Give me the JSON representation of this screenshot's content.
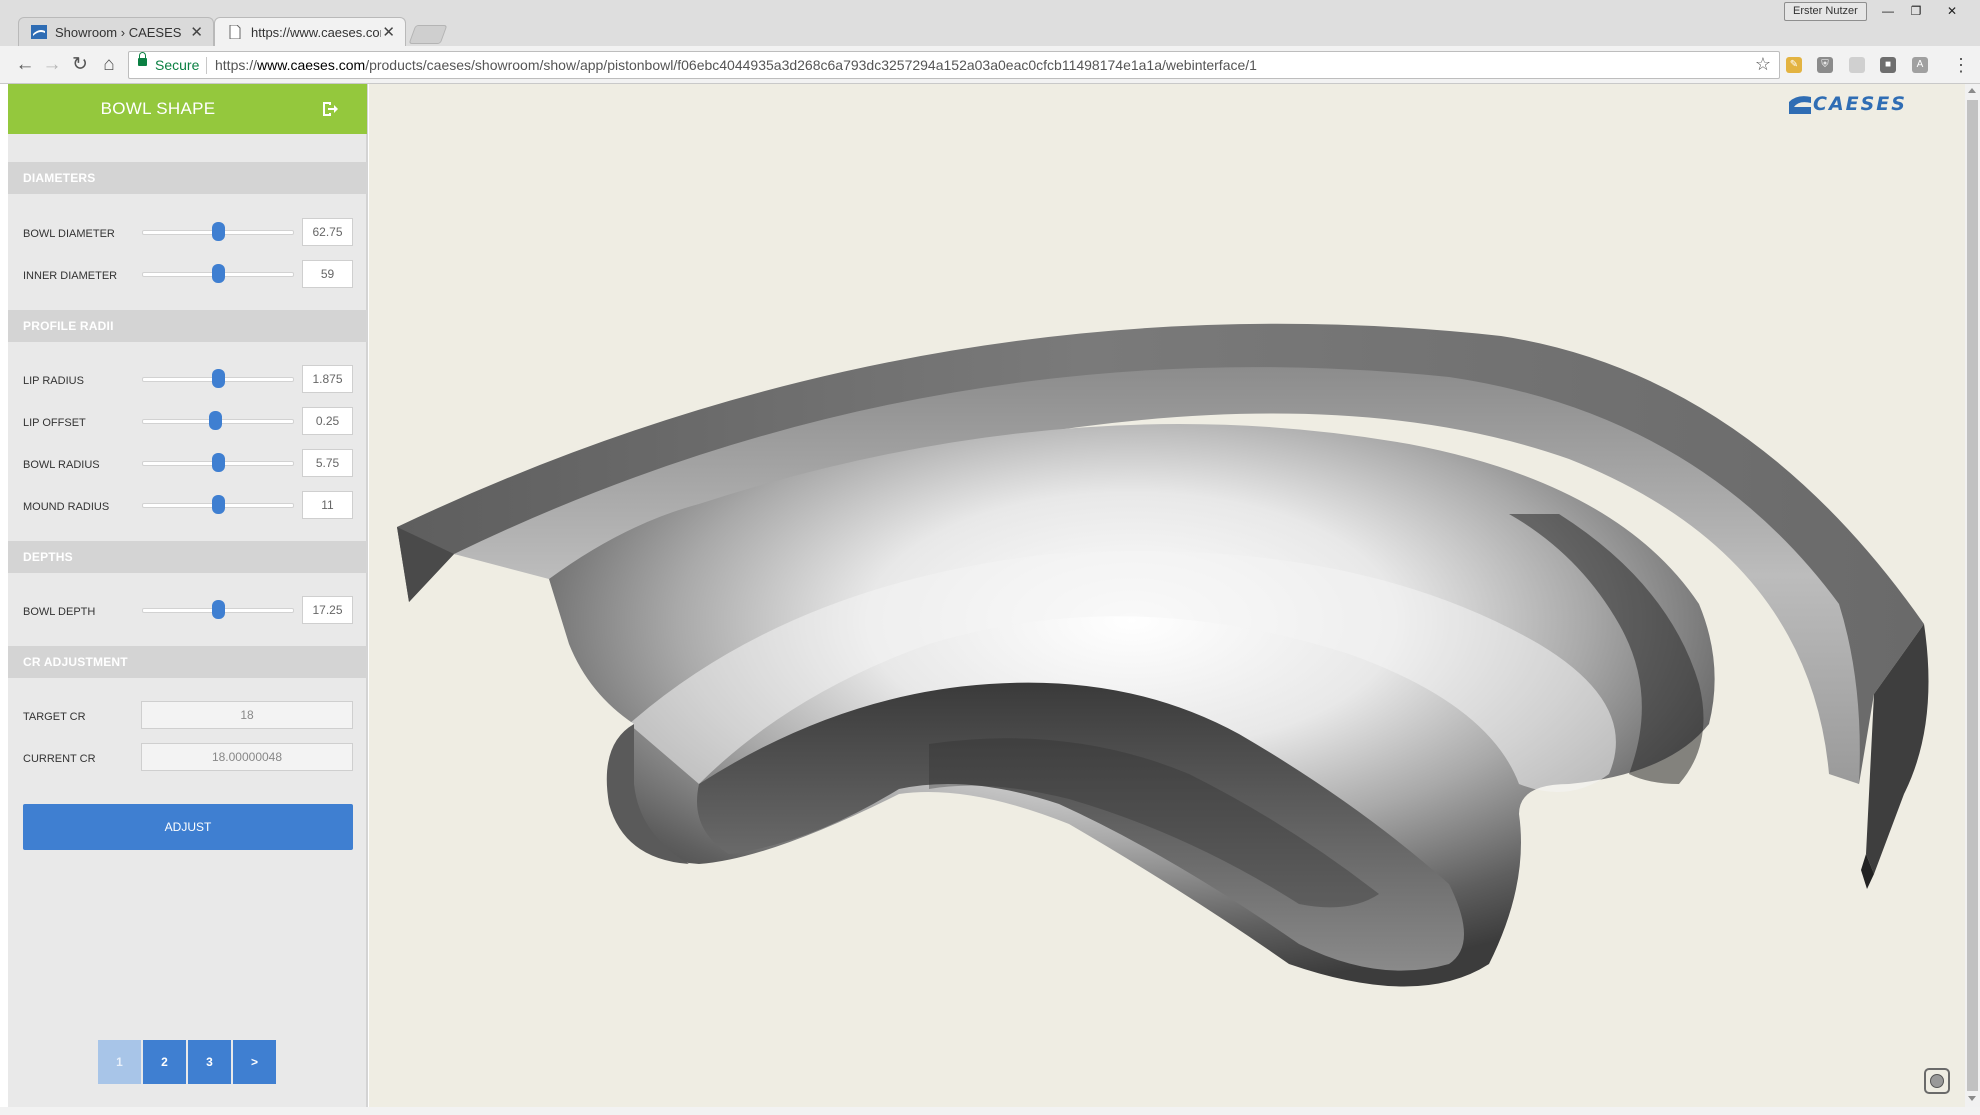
{
  "browser": {
    "tabs": [
      {
        "title": "Showroom › CAESES",
        "active": false
      },
      {
        "title": "https://www.caeses.com/",
        "active": true
      }
    ],
    "profile_label": "Erster Nutzer",
    "window_controls": {
      "minimize": "—",
      "restore": "❐",
      "close": "✕"
    },
    "security_label": "Secure",
    "url_scheme": "https://",
    "url_host": "www.caeses.com",
    "url_path": "/products/caeses/showroom/show/app/pistonbowl/f06ebc4044935a3d268c6a793dc3257294a152a03a0eac0cfcb11498174e1a1a/webinterface/1"
  },
  "panel": {
    "title": "BOWL SHAPE",
    "sections": {
      "diameters": {
        "heading": "DIAMETERS",
        "params": [
          {
            "label": "BOWL DIAMETER",
            "value": "62.75",
            "slider_fraction": 0.5
          },
          {
            "label": "INNER DIAMETER",
            "value": "59",
            "slider_fraction": 0.5
          }
        ]
      },
      "profile_radii": {
        "heading": "PROFILE RADII",
        "params": [
          {
            "label": "LIP RADIUS",
            "value": "1.875",
            "slider_fraction": 0.5
          },
          {
            "label": "LIP OFFSET",
            "value": "0.25",
            "slider_fraction": 0.48
          },
          {
            "label": "BOWL RADIUS",
            "value": "5.75",
            "slider_fraction": 0.5
          },
          {
            "label": "MOUND RADIUS",
            "value": "11",
            "slider_fraction": 0.5
          }
        ]
      },
      "depths": {
        "heading": "DEPTHS",
        "params": [
          {
            "label": "BOWL DEPTH",
            "value": "17.25",
            "slider_fraction": 0.5
          }
        ]
      },
      "cr_adjustment": {
        "heading": "CR ADJUSTMENT",
        "target_label": "TARGET CR",
        "target_value": "18",
        "current_label": "CURRENT CR",
        "current_value": "18.00000048"
      }
    },
    "adjust_label": "ADJUST",
    "pagination": [
      "1",
      "2",
      "3",
      ">"
    ],
    "current_page": "1"
  },
  "viewer": {
    "logo_text": "CAESES",
    "logo_color": "#2f6db4",
    "background": "#efede3"
  },
  "colors": {
    "accent_green": "#94c83d",
    "accent_blue": "#3f7fd1"
  }
}
